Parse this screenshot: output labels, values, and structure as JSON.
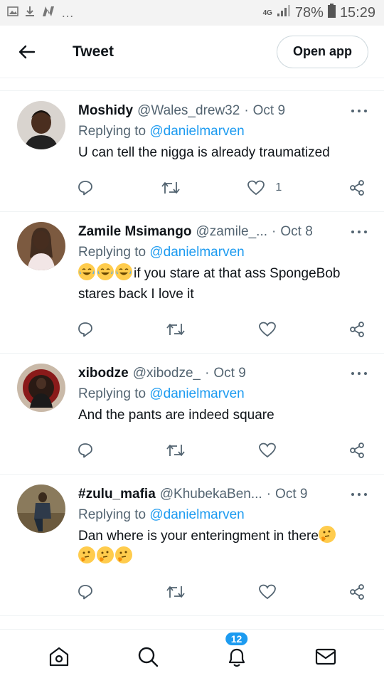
{
  "status_bar": {
    "battery": "78%",
    "time": "15:29",
    "network": "4G"
  },
  "header": {
    "title": "Tweet",
    "open_app": "Open app"
  },
  "replying_prefix": "Replying to",
  "tweets": [
    {
      "name": "Moshidy",
      "handle": "@Wales_drew32",
      "date": "Oct 9",
      "mention": "@danielmarven",
      "text": "U can tell the nigga is already traumatized",
      "like_count": "1"
    },
    {
      "name": "Zamile Msimango",
      "handle": "@zamile_...",
      "date": "Oct 8",
      "mention": "@danielmarven",
      "text": "if you stare at that ass SpongeBob stares back I love it",
      "leading_emojis": [
        "joy",
        "joy",
        "joy"
      ]
    },
    {
      "name": "xibodze",
      "handle": "@xibodze_",
      "date": "Oct 9",
      "mention": "@danielmarven",
      "text": "And the pants are indeed square"
    },
    {
      "name": "#zulu_mafia",
      "handle": "@KhubekaBen...",
      "date": "Oct 9",
      "mention": "@danielmarven",
      "text": "Dan where is your enteringment in there",
      "trailing_emojis": [
        "thinking",
        "thinking",
        "thinking",
        "thinking"
      ]
    }
  ],
  "bottom_nav": {
    "notifications_badge": "12"
  },
  "colors": {
    "accent": "#1d9bf0",
    "muted": "#536471",
    "text": "#0f1419"
  }
}
